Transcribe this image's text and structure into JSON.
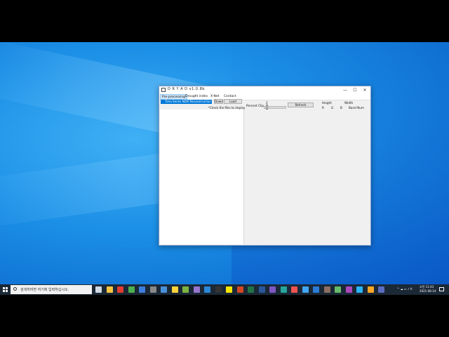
{
  "window": {
    "title": "D R Y A D v1.0.8b",
    "minimize": "—",
    "maximize": "☐",
    "close": "✕"
  },
  "menu": {
    "items": [
      "Pre-processing",
      "Drought index",
      "X-Net",
      "Contact"
    ]
  },
  "leftpanel": {
    "dropdown_value": "Time Series NDVI Reconstruction",
    "down_button": "Down",
    "load_button": "Load",
    "hint": "*Check the files to display"
  },
  "rightpanel": {
    "percent_clip_label": "Percent Clip",
    "percent_clip_value": "2",
    "percent_clip_fraction": 0.02,
    "refresh_button": "Refresh",
    "height_label": "Height",
    "width_label": "Width",
    "r_label": "R",
    "g_label": "G",
    "b_label": "B",
    "band_num_label": "Band Num"
  },
  "taskbar": {
    "search_placeholder": "검색하려면 여기에 입력하십시오.",
    "time": "오전 11:43",
    "date": "2021-08-14",
    "icons": [
      "task-view-icon",
      "file-explorer-icon",
      "opera-icon",
      "chrome-icon",
      "mail-icon",
      "calculator-icon",
      "window-icon",
      "python-icon",
      "app-icon",
      "app-icon",
      "edge-icon",
      "terminal-icon",
      "kakaotalk-icon",
      "powerpoint-icon",
      "excel-icon",
      "word-icon",
      "visual-studio-icon",
      "app-icon",
      "app-icon",
      "app-icon",
      "vscode-icon",
      "app-icon",
      "app-icon",
      "app-icon",
      "app-icon",
      "app-icon",
      "dryad-icon"
    ]
  },
  "colors": {
    "accent": "#0078d7",
    "taskbar": "#1b2836",
    "desktop": "#1b8fe6"
  }
}
